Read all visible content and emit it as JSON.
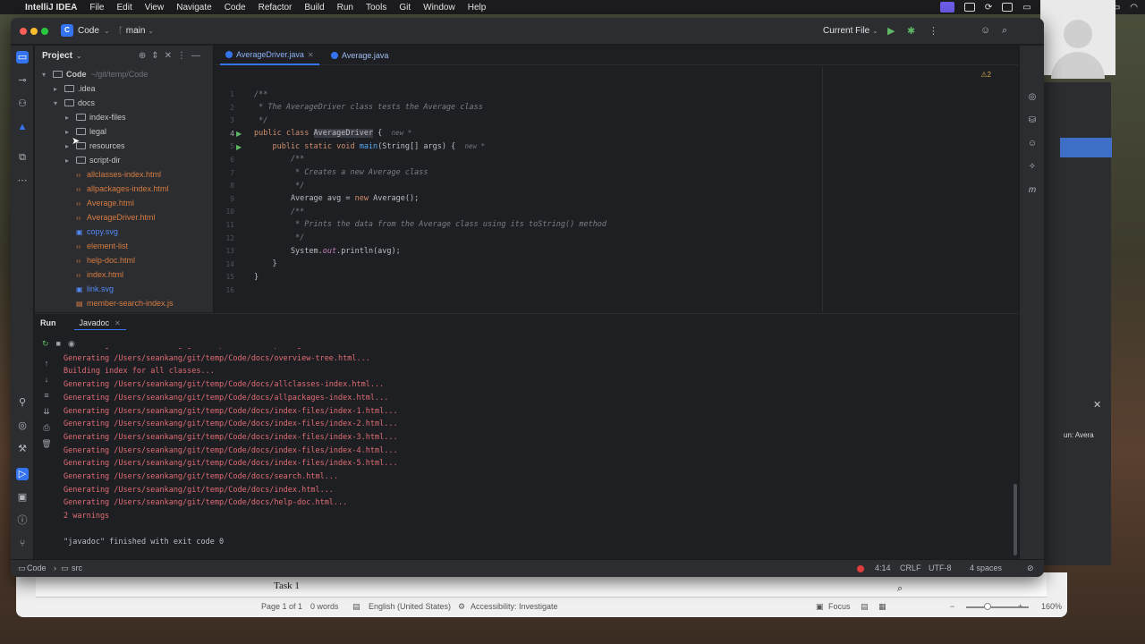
{
  "menubar": {
    "apple": "",
    "app": "IntelliJ IDEA",
    "items": [
      "File",
      "Edit",
      "View",
      "Navigate",
      "Code",
      "Refactor",
      "Build",
      "Run",
      "Tools",
      "Git",
      "Window",
      "Help"
    ]
  },
  "ide": {
    "project_badge": "C",
    "project_name": "Code",
    "branch": "main",
    "run_config": "Current File"
  },
  "project_panel": {
    "title": "Project",
    "tree": [
      {
        "label": "Code",
        "suffix": "~/git/temp/Code",
        "kind": "folder",
        "depth": 0,
        "expanded": true
      },
      {
        "label": ".idea",
        "kind": "folder",
        "depth": 1,
        "expanded": false
      },
      {
        "label": "docs",
        "kind": "folder",
        "depth": 1,
        "expanded": true
      },
      {
        "label": "index-files",
        "kind": "folder",
        "depth": 2,
        "expanded": false
      },
      {
        "label": "legal",
        "kind": "folder",
        "depth": 2,
        "expanded": false
      },
      {
        "label": "resources",
        "kind": "folder",
        "depth": 2,
        "expanded": false
      },
      {
        "label": "script-dir",
        "kind": "folder",
        "depth": 2,
        "expanded": false
      },
      {
        "label": "allclasses-index.html",
        "kind": "html",
        "depth": 2
      },
      {
        "label": "allpackages-index.html",
        "kind": "html",
        "depth": 2
      },
      {
        "label": "Average.html",
        "kind": "html",
        "depth": 2
      },
      {
        "label": "AverageDriver.html",
        "kind": "html",
        "depth": 2
      },
      {
        "label": "copy.svg",
        "kind": "svg",
        "depth": 2
      },
      {
        "label": "element-list",
        "kind": "html",
        "depth": 2
      },
      {
        "label": "help-doc.html",
        "kind": "html",
        "depth": 2
      },
      {
        "label": "index.html",
        "kind": "html",
        "depth": 2
      },
      {
        "label": "link.svg",
        "kind": "svg",
        "depth": 2
      },
      {
        "label": "member-search-index.js",
        "kind": "js",
        "depth": 2
      }
    ]
  },
  "editor": {
    "tabs": [
      {
        "label": "AverageDriver.java",
        "active": true
      },
      {
        "label": "Average.java",
        "active": false
      }
    ],
    "warnings_badge": "⚠2",
    "line_numbers": [
      "1",
      "2",
      "3",
      "4",
      "5",
      "6",
      "7",
      "8",
      "9",
      "10",
      "11",
      "12",
      "13",
      "14",
      "15",
      "16"
    ],
    "code": {
      "l1": "/**",
      "l2": " * The AverageDriver class tests the Average class",
      "l3": " */",
      "l4_kw": "public class ",
      "l4_name": "AverageDriver",
      "l4_rest": " {",
      "l4_hint": "new *",
      "l5_kw": "    public static void ",
      "l5_fn": "main",
      "l5_rest": "(String[] args) {",
      "l5_hint": "new *",
      "l6": "        /**",
      "l7": "         * Creates a new Average class",
      "l8": "         */",
      "l9_a": "        Average avg = ",
      "l9_kw": "new ",
      "l9_b": "Average();",
      "l10": "        /**",
      "l11": "         * Prints the data from the Average class using its toString() method",
      "l12": "         */",
      "l13_a": "        System.",
      "l13_fld": "out",
      "l13_b": ".println(avg);",
      "l14": "    }",
      "l15": "}",
      "l16": ""
    }
  },
  "run_panel": {
    "title": "Run",
    "tab": "Javadoc",
    "console": [
      "Generating /Users/seankang/git/temp/Code/docs/package-tree.html...",
      "Generating /Users/seankang/git/temp/Code/docs/overview-tree.html...",
      "Building index for all classes...",
      "Generating /Users/seankang/git/temp/Code/docs/allclasses-index.html...",
      "Generating /Users/seankang/git/temp/Code/docs/allpackages-index.html...",
      "Generating /Users/seankang/git/temp/Code/docs/index-files/index-1.html...",
      "Generating /Users/seankang/git/temp/Code/docs/index-files/index-2.html...",
      "Generating /Users/seankang/git/temp/Code/docs/index-files/index-3.html...",
      "Generating /Users/seankang/git/temp/Code/docs/index-files/index-4.html...",
      "Generating /Users/seankang/git/temp/Code/docs/index-files/index-5.html...",
      "Generating /Users/seankang/git/temp/Code/docs/search.html...",
      "Generating /Users/seankang/git/temp/Code/docs/index.html...",
      "Generating /Users/seankang/git/temp/Code/docs/help-doc.html...",
      "2 warnings"
    ],
    "finished": "\"javadoc\" finished with exit code 0"
  },
  "statusbar": {
    "crumb_project": "Code",
    "crumb_dir": "src",
    "position": "4:14",
    "line_sep": "CRLF",
    "encoding": "UTF-8",
    "indent": "4 spaces"
  },
  "word": {
    "doc_text": "Task 1",
    "page": "Page 1 of 1",
    "words": "0 words",
    "language": "English (United States)",
    "accessibility": "Accessibility: Investigate",
    "focus": "Focus",
    "zoom": "160%"
  },
  "behind_window": {
    "label": "un: Avera"
  }
}
